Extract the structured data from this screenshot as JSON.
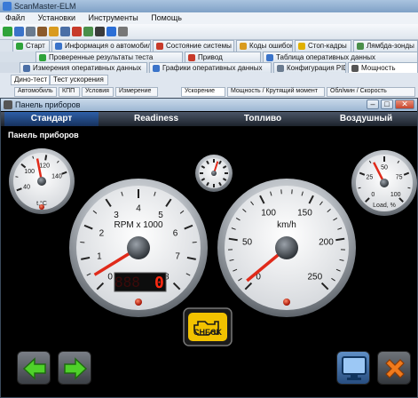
{
  "app": {
    "title": "ScanMaster-ELM",
    "menu": [
      "Файл",
      "Установки",
      "Инструменты",
      "Помощь"
    ],
    "tabs_row1": [
      {
        "label": "Старт"
      },
      {
        "label": "Информация о автомобиле"
      },
      {
        "label": "Состояние системы"
      },
      {
        "label": "Коды ошибок"
      },
      {
        "label": "Стоп-кадры"
      },
      {
        "label": "Лямбда-зонды"
      }
    ],
    "tabs_row2": [
      {
        "label": "Проверенные результаты теста"
      },
      {
        "label": "Привод"
      },
      {
        "label": "Таблица оперативных данных"
      }
    ],
    "tabs_row3": [
      {
        "label": "Измерения оперативных данных"
      },
      {
        "label": "Графики оперативных данных"
      },
      {
        "label": "Конфигурация PID"
      },
      {
        "label": "Мощность"
      }
    ],
    "subtabs1": [
      "Дино-тест",
      "Тест ускорения"
    ],
    "subtabs2": [
      "Автомобиль",
      "КПП",
      "Условия",
      "Измерение",
      "Ускорение",
      "Мощность / Крутящий момент",
      "Обл/мин / Скорость"
    ]
  },
  "dashboard": {
    "window_title": "Панель приборов",
    "modes": [
      "Стандарт",
      "Readiness",
      "Топливо",
      "Воздушный"
    ],
    "active_mode": "Стандарт",
    "panel_label": "Панель приборов",
    "gauges": {
      "temp": {
        "label": "t,°C",
        "ticks": [
          "40",
          "100",
          "120",
          "140"
        ],
        "min_label": "40",
        "value": 95
      },
      "clock": {
        "value": 0
      },
      "load": {
        "label": "Load, %",
        "ticks": [
          "0",
          "25",
          "50",
          "75",
          "100"
        ],
        "value": 40
      },
      "rpm": {
        "label": "RPM x 1000",
        "ticks": [
          "0",
          "1",
          "2",
          "3",
          "4",
          "5",
          "6",
          "7",
          "8"
        ],
        "value": 0,
        "digital": "0"
      },
      "speed": {
        "label": "km/h",
        "ticks": [
          "0",
          "50",
          "100",
          "150",
          "200",
          "250"
        ],
        "value": 0
      }
    },
    "check_engine": {
      "label": "CHECK",
      "color": "#f2c200"
    }
  },
  "colors": {
    "accent": "#2e5fa8",
    "needle": "#e02a1a",
    "arrow_green": "#4fd12a",
    "close_orange": "#f07a1c"
  }
}
